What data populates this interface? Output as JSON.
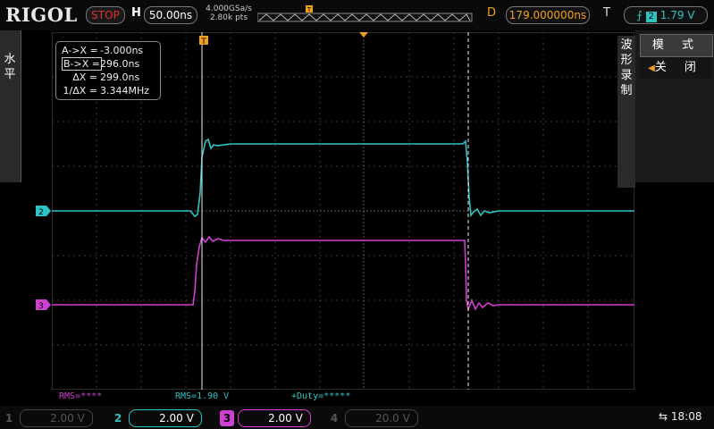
{
  "header": {
    "logo": "RIGOL",
    "run_state": "STOP",
    "horizontal_label": "H",
    "timebase": "50.00ns",
    "sample_rate": "4.000GSa/s",
    "memory_depth": "2.80k pts",
    "delay_label": "D",
    "delay": "179.000000ns",
    "trigger_label": "T",
    "trigger_source": "2",
    "trigger_level": "1.79 V"
  },
  "left_menu": {
    "label": "水平"
  },
  "right_menu": {
    "vertical_label": "波形录制",
    "mode_label": "模 式",
    "off_label": "关 闭"
  },
  "cursors": {
    "a_label": "A->X =",
    "a_value": "-3.000ns",
    "b_label": "B->X =",
    "b_value": "296.0ns",
    "dx_label": "ΔX =",
    "dx_value": "299.0ns",
    "inv_dx_label": "1/ΔX =",
    "inv_dx_value": "3.344MHz"
  },
  "measurements": {
    "m1": "RMS=****",
    "m2": "RMS=1.90 V",
    "m3": "+Duty=*****"
  },
  "channels": [
    {
      "num": "1",
      "scale": "2.00 V",
      "active": false
    },
    {
      "num": "2",
      "scale": "2.00 V",
      "active": true
    },
    {
      "num": "3",
      "scale": "2.00 V",
      "active": true
    },
    {
      "num": "4",
      "scale": "20.0 V",
      "active": false
    }
  ],
  "markers": {
    "ch2_marker": "2",
    "ch3_marker": "3",
    "trigger_marker": "T"
  },
  "status": {
    "time": "18:08"
  },
  "colors": {
    "ch2": "#2ec4c4",
    "ch3": "#d040d0",
    "accent": "#f0a020",
    "stop": "#e03030"
  }
}
